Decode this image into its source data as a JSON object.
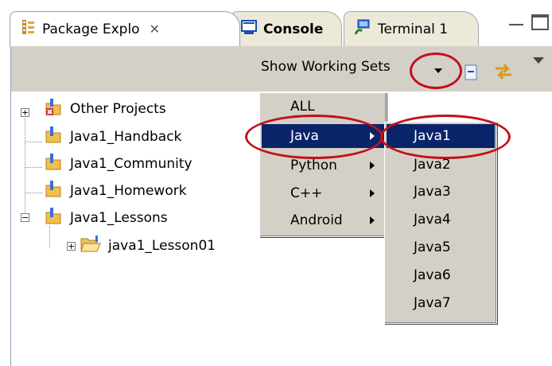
{
  "tabs": [
    {
      "label": "Package Explo",
      "active": true,
      "icon": "package-explorer-icon"
    },
    {
      "label": "Console",
      "active": false,
      "icon": "console-icon"
    },
    {
      "label": "Terminal 1",
      "active": false,
      "icon": "terminal-icon"
    }
  ],
  "toolbar": {
    "show_working_sets_label": "Show Working Sets"
  },
  "tree": [
    {
      "label": "Other Projects",
      "expanded": false,
      "icon": "closed-project-icon"
    },
    {
      "label": "Java1_Handback",
      "icon": "java-project-icon"
    },
    {
      "label": "Java1_Community",
      "icon": "java-project-icon"
    },
    {
      "label": "Java1_Homework",
      "icon": "java-project-icon"
    },
    {
      "label": "Java1_Lessons",
      "expanded": true,
      "icon": "java-project-icon"
    },
    {
      "label": "java1_Lesson01",
      "expanded": false,
      "icon": "open-folder-icon"
    }
  ],
  "working_set_menu": [
    {
      "label": "ALL",
      "has_submenu": false,
      "selected": false
    },
    {
      "label": "Java",
      "has_submenu": true,
      "selected": true
    },
    {
      "label": "Python",
      "has_submenu": true,
      "selected": false
    },
    {
      "label": "C++",
      "has_submenu": true,
      "selected": false
    },
    {
      "label": "Android",
      "has_submenu": true,
      "selected": false
    }
  ],
  "java_submenu": [
    {
      "label": "Java1",
      "selected": true
    },
    {
      "label": "Java2",
      "selected": false
    },
    {
      "label": "Java3",
      "selected": false
    },
    {
      "label": "Java4",
      "selected": false
    },
    {
      "label": "Java5",
      "selected": false
    },
    {
      "label": "Java6",
      "selected": false
    },
    {
      "label": "Java7",
      "selected": false
    }
  ],
  "colors": {
    "highlight_bg": "#0a246a",
    "annotation_circle": "#c0121b",
    "toolbar_bg": "#d4d0c8"
  }
}
